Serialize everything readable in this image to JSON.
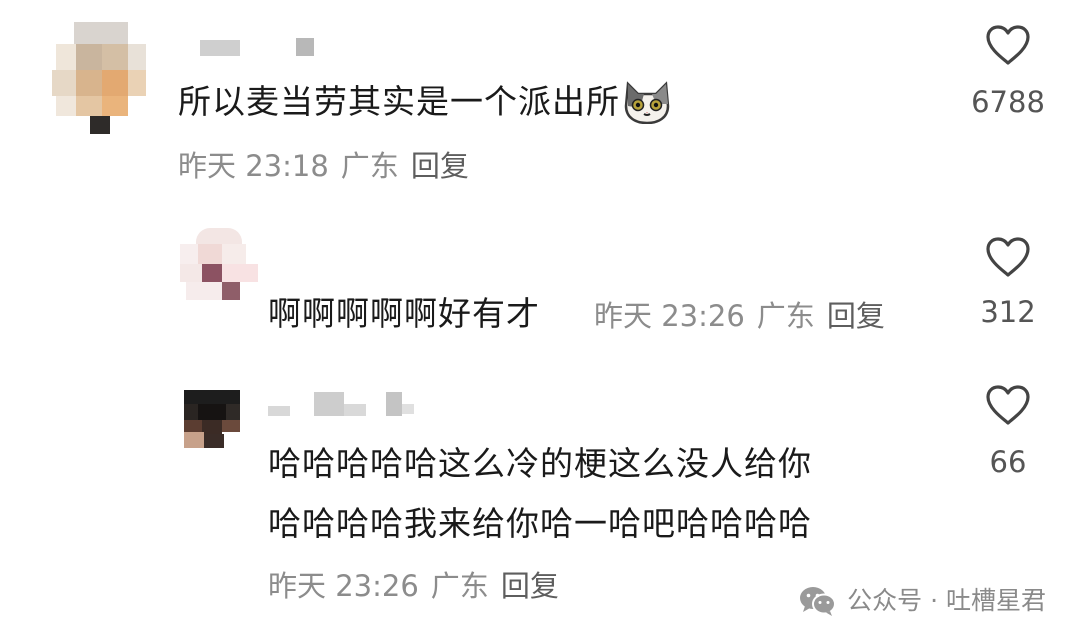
{
  "comments": [
    {
      "text": "所以麦当劳其实是一个派出所",
      "emoji": "cat-face-emoji",
      "time": "昨天 23:18",
      "location": "广东",
      "reply_label": "回复",
      "like_count": "6788"
    },
    {
      "text": "啊啊啊啊啊好有才",
      "time": "昨天 23:26",
      "location": "广东",
      "reply_label": "回复",
      "like_count": "312"
    },
    {
      "text_line1": "哈哈哈哈哈这么冷的梗这么没人给你",
      "text_line2": "哈哈哈哈我来给你哈一哈吧哈哈哈哈",
      "time": "昨天 23:26",
      "location": "广东",
      "reply_label": "回复",
      "like_count": "66"
    }
  ],
  "watermark": {
    "icon": "wechat-icon",
    "text": "公众号 · 吐槽星君"
  },
  "colors": {
    "text": "#1a1a1a",
    "meta": "#8c8c8c",
    "heart_outline": "#444444"
  }
}
